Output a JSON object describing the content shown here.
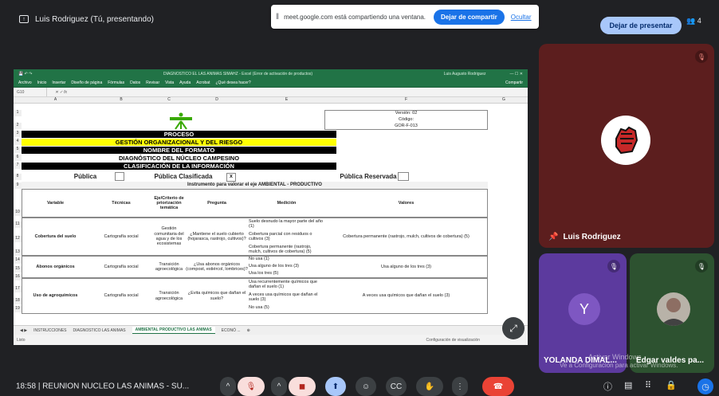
{
  "presenter": {
    "label": "Luis Rodriguez (Tú, presentando)"
  },
  "share_banner": {
    "message": "meet.google.com está compartiendo una ventana.",
    "stop_label": "Dejar de compartir",
    "hide_label": "Ocultar"
  },
  "stop_presenting": "Dejar de presentar",
  "people_count": "4",
  "excel": {
    "window_title": "DIAGNOSTICO EL LAS ANIMAS SIMAHZ - Excel (Error de activación de productos)",
    "user": "Luis Augusto Rodriguez",
    "ribbon": [
      "Archivo",
      "Inicio",
      "Insertar",
      "Diseño de página",
      "Fórmulas",
      "Datos",
      "Revisar",
      "Vista",
      "Ayuda",
      "Acrobat",
      "¿Qué desea hacer?"
    ],
    "share": "Compartir",
    "namebox": "G10",
    "columns": [
      "A",
      "B",
      "C",
      "D",
      "E",
      "F",
      "G"
    ],
    "version": "Versión: 02",
    "codigo": "Código:",
    "code": "GOR-F-013",
    "bands": [
      "PROCESO",
      "GESTIÓN ORGANIZACIONAL Y DEL RIESGO",
      "NOMBRE DEL FORMATO",
      "DIAGNÓSTICO DEL NÚCLEO CAMPESINO",
      "CLASIFICACIÓN DE LA INFORMACIÓN"
    ],
    "classification": {
      "publica": "Pública",
      "clasificada": "Pública Clasificada",
      "reservada": "Pública Reservada",
      "mark": "x"
    },
    "instrument": "Instrumento para valorar el eje AMBIENTAL - PRODUCTIVO",
    "headers": [
      "Variable",
      "Técnicas",
      "Eje/Criterio de priorización temática",
      "Pregunta",
      "Medición",
      "Valores"
    ],
    "rows": [
      {
        "variable": "Cobertura del suelo",
        "tecnica": "Cartografía social",
        "eje": "Gestión comunitaria del agua y de los ecosistemas",
        "pregunta": "¿Mantiene el suelo cubierto (hojarasca, rastrojo, cultivos)?",
        "medicion": [
          "Suelo desnudo la mayor parte del año (1)",
          "Cobertura parcial con residuos o cultivos (3)",
          "Cobertura permanente (rastrojo, mulch, cultivos de cobertura) (5)"
        ],
        "valor": "Cobertura permanente (rastrojo, mulch, cultivos de cobertura) (5)"
      },
      {
        "variable": "Abonos orgánicos",
        "tecnica": "Cartografía social",
        "eje": "Transición agroecológica",
        "pregunta": "¿Usa abonos orgánicos (compost, estiércol, lombrices)?",
        "medicion": [
          "No usa (1)",
          "Usa alguno de los tres (3)",
          "Usa los tres (5)"
        ],
        "valor": "Usa alguno de los tres (3)"
      },
      {
        "variable": "Uso de agroquímicos",
        "tecnica": "Cartografía social",
        "eje": "Transición agroecológica",
        "pregunta": "¿Evita químicos que dañan el suelo?",
        "medicion": [
          "Usa recurrentemente químicos que dañan el suelo (1)",
          "A veces usa químicos que dañan el suelo (3)",
          "No usa (5)"
        ],
        "valor": "A veces usa químicos que dañan el suelo (3)"
      }
    ],
    "tabs": [
      "INSTRUCCIONES",
      "DIAGNOSTICO LAS ANIMAS",
      "AMBIENTAL PRODUCTIVO LAS ANIMAS",
      "ECONÓ ..."
    ],
    "status_left": "Listo",
    "status_cfg": "Configuración de visualización",
    "row_numbers": [
      "1",
      "2",
      "3",
      "4",
      "5",
      "6",
      "7",
      "8",
      "9",
      "10",
      "11",
      "12",
      "13",
      "14",
      "15",
      "16",
      "17",
      "18",
      "19"
    ]
  },
  "participants": [
    {
      "name": "Luis Rodriguez"
    },
    {
      "name": "YOLANDA DIMAL...",
      "initial": "Y"
    },
    {
      "name": "Edgar valdes pa..."
    }
  ],
  "watermark": {
    "line1": "Activar Windows",
    "line2": "Ve a Configuración para activar Windows."
  },
  "meeting": {
    "time": "18:58",
    "title": "REUNION NUCLEO LAS ANIMAS - SU..."
  },
  "colors": {
    "accent": "#1a73e8",
    "excel_green": "#217346",
    "banner_yellow": "#ffff00"
  }
}
